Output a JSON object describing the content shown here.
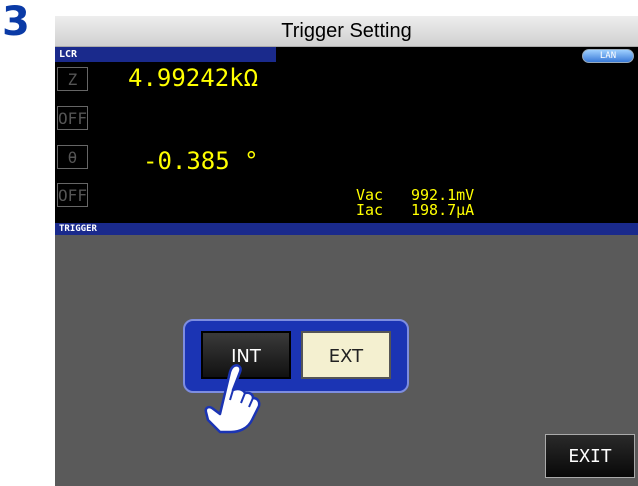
{
  "step_number": "3",
  "title": "Trigger Setting",
  "status_bar": {
    "mode": "LCR",
    "lan": "LAN"
  },
  "measurements": {
    "param1": {
      "name": "Z",
      "value": "4.99242kΩ"
    },
    "param2": {
      "name": "OFF"
    },
    "param3": {
      "name": "θ",
      "value": "-0.385 °"
    },
    "param4": {
      "name": "OFF"
    },
    "vac": {
      "label": "Vac",
      "value": "992.1mV"
    },
    "iac": {
      "label": "Iac",
      "value": "198.7μA"
    }
  },
  "trigger_section": {
    "label": "TRIGGER",
    "options": [
      "INT",
      "EXT"
    ],
    "selected": "INT"
  },
  "exit_label": "EXIT"
}
